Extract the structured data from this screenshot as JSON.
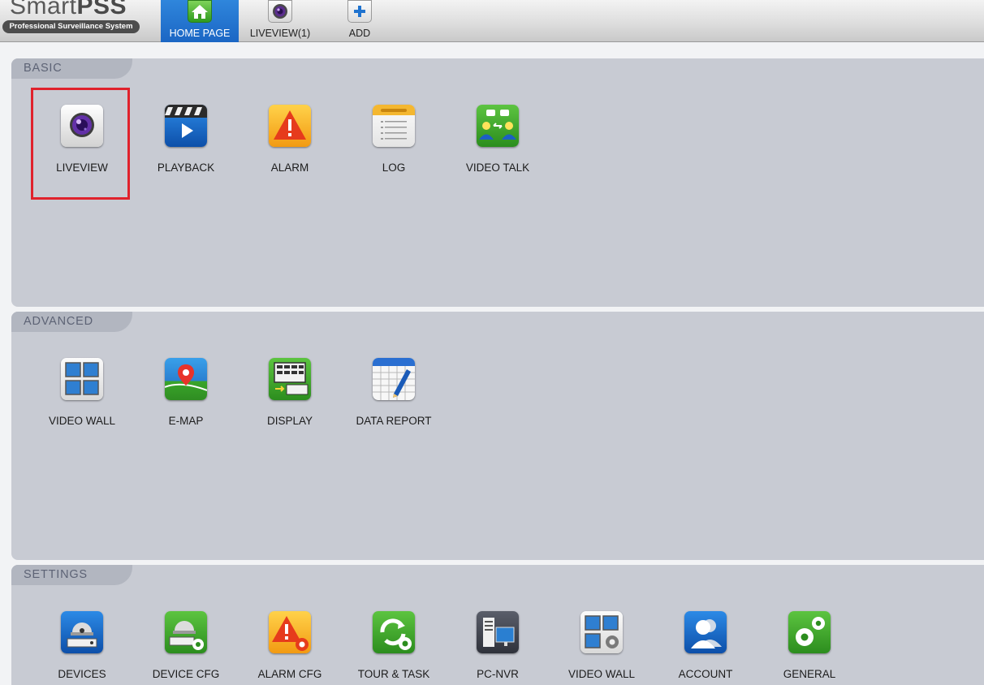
{
  "app": {
    "logo_light": "Smart",
    "logo_bold": "PSS",
    "logo_tagline": "Professional Surveillance System"
  },
  "tabs": [
    {
      "label": "HOME PAGE",
      "icon": "home-icon",
      "active": true
    },
    {
      "label": "LIVEVIEW(1)",
      "icon": "camera-lens-icon",
      "active": false
    },
    {
      "label": "ADD",
      "icon": "plus-icon",
      "active": false
    }
  ],
  "sections": {
    "basic": {
      "title": "BASIC",
      "items": [
        {
          "label": "LIVEVIEW",
          "icon": "camera-lens-icon",
          "highlighted": true
        },
        {
          "label": "PLAYBACK",
          "icon": "clapperboard-play-icon"
        },
        {
          "label": "ALARM",
          "icon": "warning-triangle-icon"
        },
        {
          "label": "LOG",
          "icon": "notepad-icon"
        },
        {
          "label": "VIDEO TALK",
          "icon": "people-chat-icon"
        }
      ]
    },
    "advanced": {
      "title": "ADVANCED",
      "items": [
        {
          "label": "VIDEO WALL",
          "icon": "screen-grid-icon"
        },
        {
          "label": "E-MAP",
          "icon": "map-pin-icon"
        },
        {
          "label": "DISPLAY",
          "icon": "display-matrix-icon"
        },
        {
          "label": "DATA REPORT",
          "icon": "spreadsheet-pencil-icon"
        }
      ]
    },
    "settings": {
      "title": "SETTINGS",
      "items": [
        {
          "label": "DEVICES",
          "icon": "dome-camera-icon"
        },
        {
          "label": "DEVICE CFG",
          "icon": "dome-camera-gear-icon"
        },
        {
          "label": "ALARM CFG",
          "icon": "warning-gear-icon"
        },
        {
          "label": "TOUR & TASK",
          "icon": "refresh-gear-icon"
        },
        {
          "label": "PC-NVR",
          "icon": "pc-nvr-icon"
        },
        {
          "label": "VIDEO WALL",
          "icon": "screen-grid-gear-icon"
        },
        {
          "label": "ACCOUNT",
          "icon": "user-account-icon"
        },
        {
          "label": "GENERAL",
          "icon": "gears-icon"
        }
      ]
    }
  },
  "colors": {
    "active_tab": "#1b66c4",
    "panel_bg": "#c8cbd3",
    "highlight": "#e0222c"
  }
}
